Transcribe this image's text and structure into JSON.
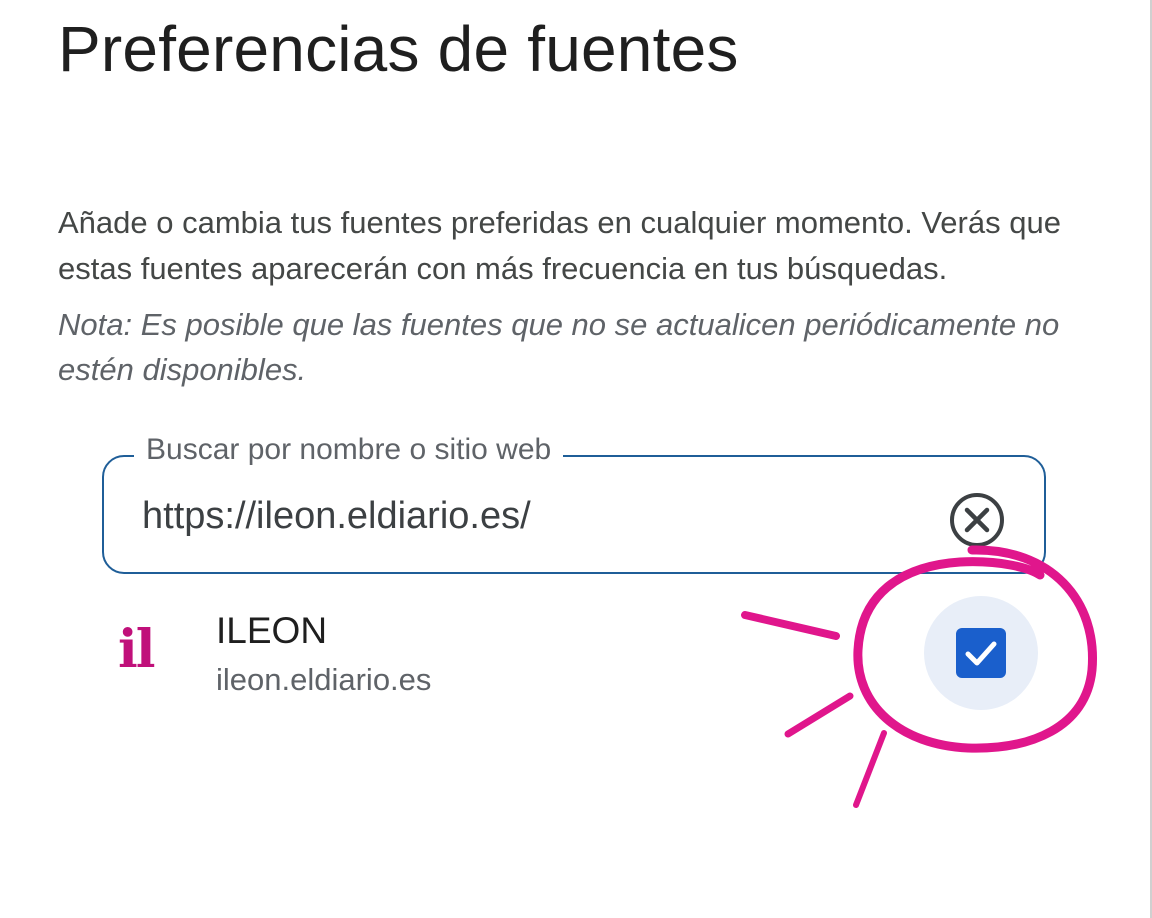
{
  "page": {
    "title": "Preferencias de fuentes",
    "description": "Añade o cambia tus fuentes preferidas en cualquier momento. Verás que estas fuentes aparecerán con más frecuencia en tus búsquedas.",
    "note": "Nota: Es posible que las fuentes que no se actualicen periódicamente no estén disponibles."
  },
  "search": {
    "label": "Buscar por nombre o sitio web",
    "value": "https://ileon.eldiario.es/",
    "clear_icon": "close-circle-icon"
  },
  "results": [
    {
      "logo_text": "il",
      "name": "ILEON",
      "url": "ileon.eldiario.es",
      "checked": true
    }
  ],
  "colors": {
    "field_border": "#1f5e98",
    "checkbox": "#1a5fcc",
    "logo": "#c0107a",
    "annotation": "#e0168c"
  }
}
